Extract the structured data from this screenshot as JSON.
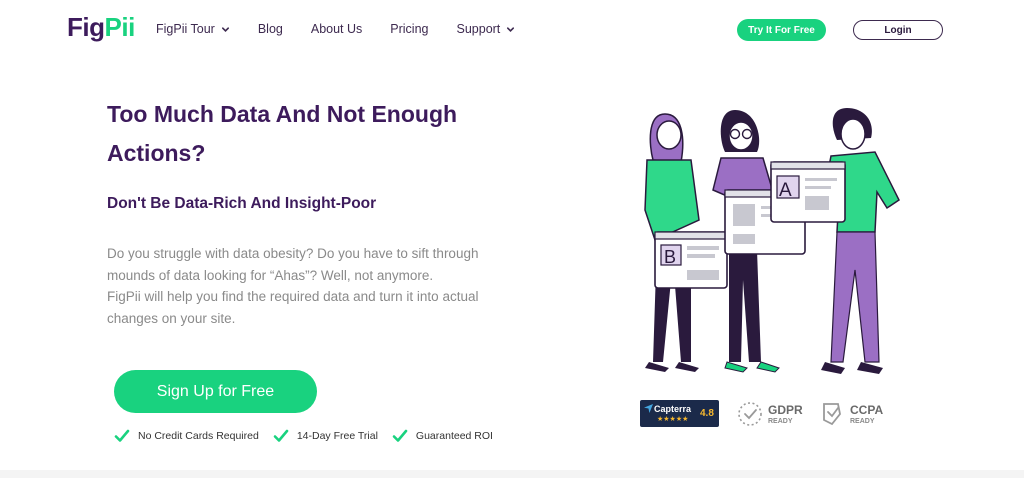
{
  "header": {
    "logo_left": "Fig",
    "logo_right": "Pii",
    "nav": [
      {
        "label": "FigPii Tour",
        "icon": "chevron-down-icon"
      },
      {
        "label": "Blog"
      },
      {
        "label": "About Us"
      },
      {
        "label": "Pricing"
      },
      {
        "label": "Support",
        "icon": "chevron-down-icon"
      }
    ],
    "try_label": "Try It For Free",
    "login_label": "Login"
  },
  "hero": {
    "title": "Too Much Data And Not Enough Actions?",
    "subtitle": "Don't Be Data-Rich And Insight-Poor",
    "body_1": "Do you struggle with data obesity? Do you have to sift through mounds of data looking for “Ahas”? Well, not anymore.",
    "body_2": "FigPii will help you find the required data and turn it into actual changes on your site.",
    "cta_label": "Sign Up for Free",
    "features": [
      "No Credit Cards Required",
      "14-Day Free Trial",
      "Guaranteed ROI"
    ]
  },
  "illustration": {
    "panel_a_letter": "A",
    "panel_b_letter": "B"
  },
  "badges": {
    "capterra_name": "Capterra",
    "capterra_stars": "★★★★★",
    "capterra_score": "4.8",
    "gdpr_main": "GDPR",
    "gdpr_sub": "READY",
    "ccpa_main": "CCPA",
    "ccpa_sub": "READY"
  },
  "colors": {
    "brand_green": "#19d27f",
    "brand_purple": "#3d1b5c",
    "body_gray": "#8a8a8a"
  }
}
